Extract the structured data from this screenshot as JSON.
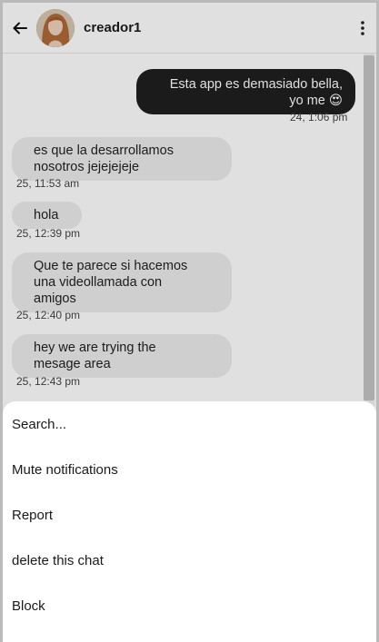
{
  "header": {
    "contact_name": "creador1"
  },
  "messages": [
    {
      "direction": "out",
      "text_line1": "Esta app es demasiado bella,",
      "text_line2": "yo me 😍",
      "timestamp": "24, 1:06 pm"
    },
    {
      "direction": "in",
      "text_line1": "es que la desarrollamos",
      "text_line2": "nosotros jejejejeje",
      "timestamp": "25, 11:53 am"
    },
    {
      "direction": "in",
      "text_line1": "hola",
      "timestamp": "25, 12:39 pm"
    },
    {
      "direction": "in",
      "text_line1": "Que te parece si hacemos",
      "text_line2": "una videollamada con",
      "text_line3": "amigos",
      "timestamp": "25, 12:40 pm"
    },
    {
      "direction": "in",
      "text_line1": "hey we are trying the",
      "text_line2": "mesage area",
      "timestamp": "25, 12:43 pm"
    }
  ],
  "menu": {
    "items": [
      {
        "label": "Search..."
      },
      {
        "label": "Mute notifications"
      },
      {
        "label": "Report"
      },
      {
        "label": "delete this chat"
      },
      {
        "label": "Block"
      }
    ]
  },
  "icons": {
    "back": "arrow-left-icon",
    "menu": "more-vertical-icon"
  },
  "colors": {
    "outgoing_bubble": "#1f1f1f",
    "incoming_bubble": "#ececec"
  }
}
